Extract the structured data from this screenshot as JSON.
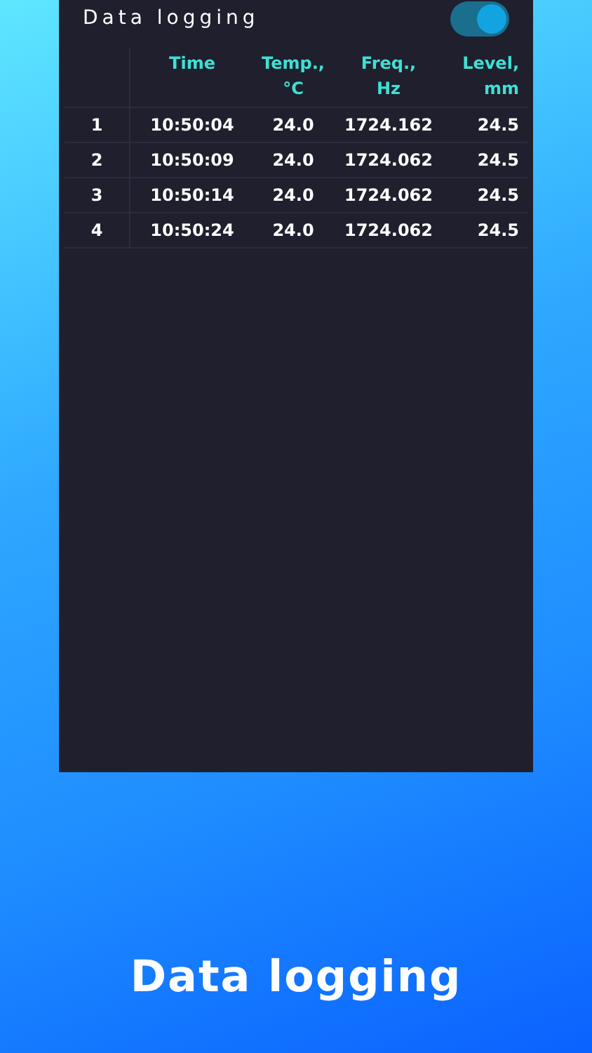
{
  "screen": {
    "title": "Data logging",
    "logging_toggle": {
      "on": true
    },
    "table": {
      "columns": [
        {
          "lines": [
            "Time"
          ]
        },
        {
          "lines": [
            "Temp.,",
            "°C"
          ]
        },
        {
          "lines": [
            "Freq.,",
            "Hz"
          ]
        },
        {
          "lines": [
            "Level,",
            "mm"
          ]
        }
      ],
      "rows": [
        {
          "index": "1",
          "time": "10:50:04",
          "temp": "24.0",
          "freq": "1724.162",
          "level": "24.5"
        },
        {
          "index": "2",
          "time": "10:50:09",
          "temp": "24.0",
          "freq": "1724.062",
          "level": "24.5"
        },
        {
          "index": "3",
          "time": "10:50:14",
          "temp": "24.0",
          "freq": "1724.062",
          "level": "24.5"
        },
        {
          "index": "4",
          "time": "10:50:24",
          "temp": "24.0",
          "freq": "1724.062",
          "level": "24.5"
        }
      ]
    }
  },
  "caption": "Data logging"
}
